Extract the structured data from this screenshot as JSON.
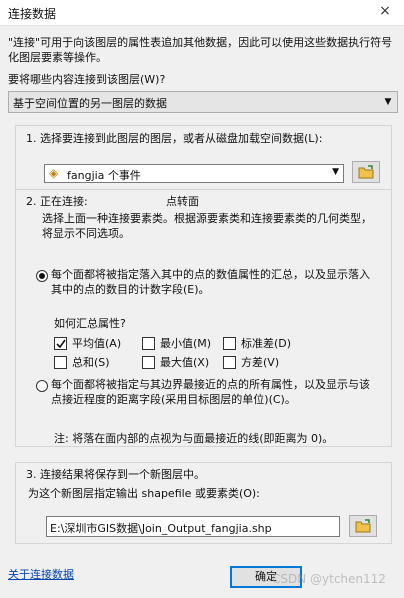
{
  "window": {
    "title": "连接数据",
    "close_symbol": "×"
  },
  "description": "\"连接\"可用于向该图层的属性表追加其他数据，因此可以使用这些数据执行符号化图层要素等操作。",
  "join_question": "要将哪些内容连接到该图层(W)?",
  "join_type_value": "基于空间位置的另一图层的数据",
  "step1": {
    "label": "1. 选择要连接到此图层的图层，或者从磁盘加载空间数据(L):",
    "layer_value": "fangjia 个事件"
  },
  "step2": {
    "label": "2. 正在连接:",
    "layer_type": "点转面",
    "instruction": "选择上面一种连接要素类。根据源要素类和连接要素类的几何类型，将显示不同选项。",
    "option1": "每个面都将被指定落入其中的点的数值属性的汇总，以及显示落入其中的点的数目的计数字段(E)。",
    "summary_question": "如何汇总属性?",
    "checks": [
      {
        "label": "平均值(A)",
        "checked": true
      },
      {
        "label": "最小值(M)",
        "checked": false
      },
      {
        "label": "标准差(D)",
        "checked": false
      },
      {
        "label": "总和(S)",
        "checked": false
      },
      {
        "label": "最大值(X)",
        "checked": false
      },
      {
        "label": "方差(V)",
        "checked": false
      }
    ],
    "option2": "每个面都将被指定与其边界最接近的点的所有属性，以及显示与该点接近程度的距离字段(采用目标图层的单位)(C)。",
    "note": "注: 将落在面内部的点视为与面最接近的线(即距离为 0)。",
    "selected_option": 1
  },
  "step3": {
    "label": "3. 连接结果将保存到一个新图层中。",
    "sublabel": "为这个新图层指定输出 shapefile 或要素类(O):",
    "output_path": "E:\\深圳市GIS数据\\Join_Output_fangjia.shp"
  },
  "footer": {
    "help_link": "关于连接数据",
    "ok_button": "确定",
    "watermark": "CSDN @ytchen112"
  },
  "colors": {
    "link": "#0645ad",
    "default_button_border": "#0078d7"
  }
}
